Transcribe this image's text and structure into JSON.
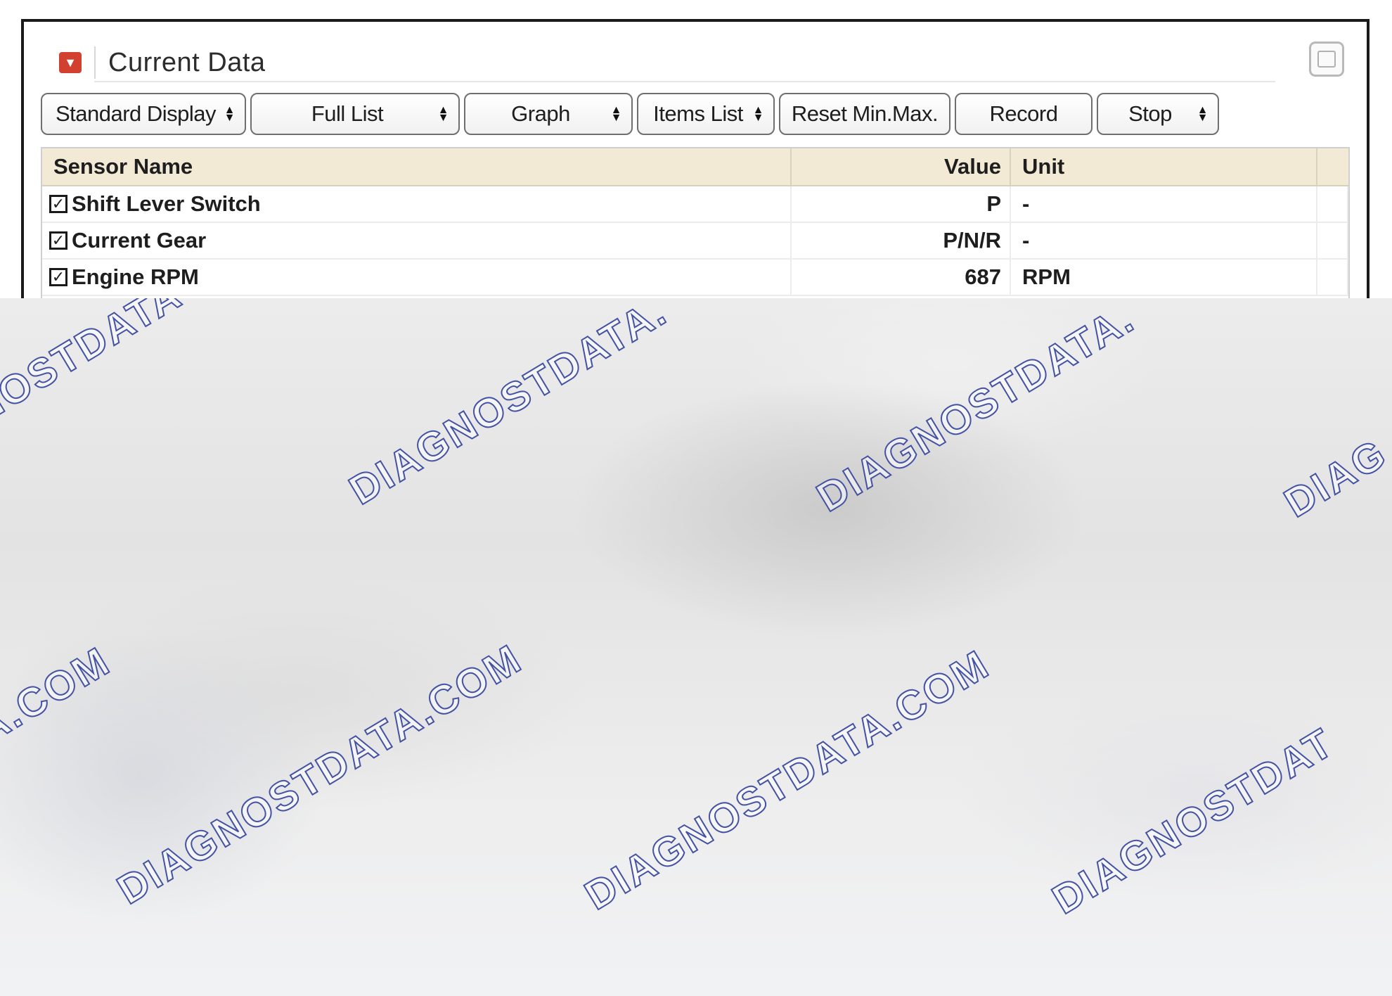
{
  "window": {
    "title": "Current Data",
    "icon": "collapse-icon",
    "icon_color": "#d2402f"
  },
  "toolbar": {
    "buttons": [
      {
        "label": "Standard Display",
        "has_arrow": true
      },
      {
        "label": "Full List",
        "has_arrow": true
      },
      {
        "label": "Graph",
        "has_arrow": true
      },
      {
        "label": "Items List",
        "has_arrow": true
      },
      {
        "label": "Reset Min.Max.",
        "has_arrow": false
      },
      {
        "label": "Record",
        "has_arrow": false
      },
      {
        "label": "Stop",
        "has_arrow": true
      }
    ]
  },
  "table": {
    "header_color": "#f3ead5",
    "columns": [
      "Sensor Name",
      "Value",
      "Unit"
    ],
    "rows": [
      {
        "name": "Shift Lever Switch",
        "value": "P",
        "unit": "-",
        "checked": true
      },
      {
        "name": "Current Gear",
        "value": "P/N/R",
        "unit": "-",
        "checked": true
      },
      {
        "name": "Engine RPM",
        "value": "687",
        "unit": "RPM",
        "checked": true
      }
    ]
  },
  "watermark": {
    "text_a": "DIAGNOSTDATA.",
    "text_b": "DIAGNOSTDATA.COM",
    "text_c": "DIAGNOSTDATA",
    "text_d": "A.COM",
    "text_e": "DIAG",
    "text_f": "GNOSTDATA",
    "text_g": "DIAGNOSTDAT",
    "stroke_color": "#4452a3"
  }
}
